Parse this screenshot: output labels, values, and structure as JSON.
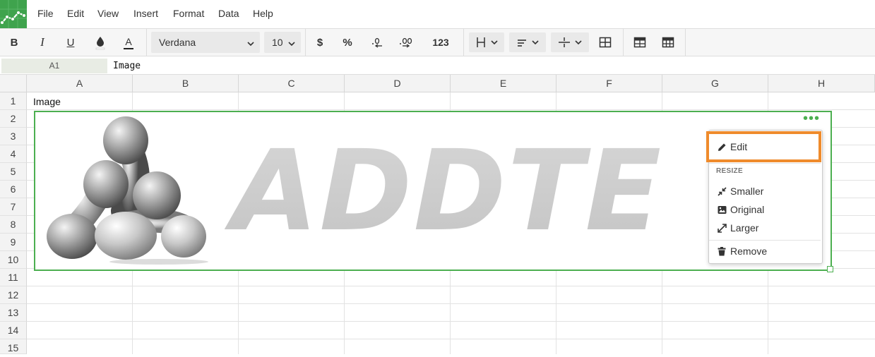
{
  "menu": {
    "items": [
      "File",
      "Edit",
      "View",
      "Insert",
      "Format",
      "Data",
      "Help"
    ]
  },
  "toolbar": {
    "bold": "B",
    "italic": "I",
    "underline": "U",
    "text_color": "A",
    "font_family": "Verdana",
    "font_size": "10",
    "currency": "$",
    "percent": "%",
    "number_format": "123"
  },
  "formula_bar": {
    "cell_ref": "A1",
    "value": "Image"
  },
  "sheet": {
    "columns": [
      "A",
      "B",
      "C",
      "D",
      "E",
      "F",
      "G",
      "H"
    ],
    "rows": [
      "1",
      "2",
      "3",
      "4",
      "5",
      "6",
      "7",
      "8",
      "9",
      "10",
      "11",
      "12",
      "13",
      "14",
      "15"
    ],
    "a1": "Image"
  },
  "image": {
    "logo_text": "ADDTE",
    "menu_dots": "•••"
  },
  "popup": {
    "edit": "Edit",
    "resize_header": "RESIZE",
    "smaller": "Smaller",
    "original": "Original",
    "larger": "Larger",
    "remove": "Remove"
  },
  "colors": {
    "accent_green": "#4caf50",
    "highlight_orange": "#ef8b2c"
  }
}
